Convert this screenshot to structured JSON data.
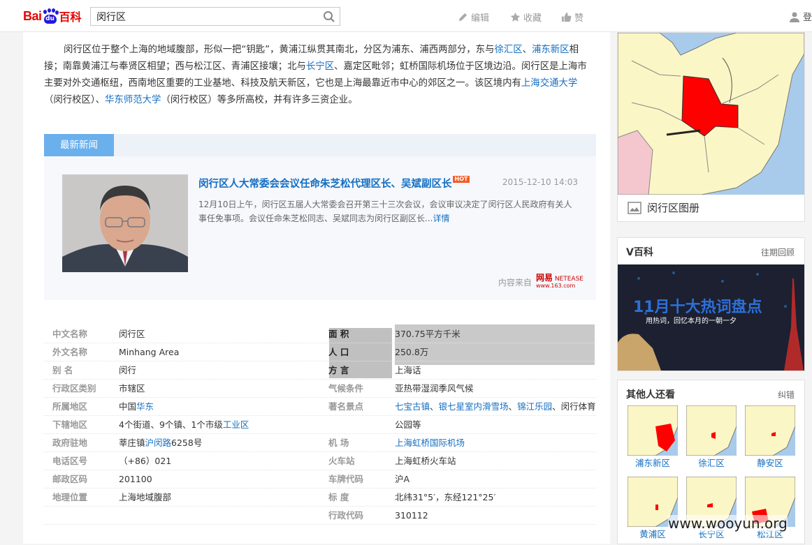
{
  "header": {
    "logo_bai": "Bai",
    "logo_du": "du",
    "logo_baike": "百科",
    "search_value": "闵行区",
    "edit_label": "编辑",
    "collect_label": "收藏",
    "like_label": "赞",
    "login_label": "登"
  },
  "intro": {
    "p1": "闵行区位于整个上海的地域腹部，形似一把“钥匙”，黄浦江纵贯其南北，分区为浦东、浦西两部分，东与",
    "link_xuhui": "徐汇区",
    "sep1": "、",
    "link_pudong": "浦东新区",
    "p2": "相接；南靠黄浦江与奉贤区相望；西与松江区、青浦区接壤；北与",
    "link_changning": "长宁区",
    "p3": "、嘉定区毗邻；虹桥国际机场位于区境边沿。闵行区是上海市主要对外交通枢纽，西南地区重要的工业基地、科技及航天新区，它也是上海最靠近市中心的郊区之一。该区境内有",
    "link_sjtu": "上海交通大学",
    "p4": "（闵行校区）、",
    "link_ecnu": "华东师范大学",
    "p5": "（闵行校区）等多所高校，并有许多三资企业。"
  },
  "news": {
    "tab_label": "最新新闻",
    "title": "闵行区人大常委会会议任命朱芝松代理区长、吴斌副区长",
    "hot_badge": "HOT",
    "date": "2015-12-10 14:03",
    "summary": "12月10日上午，闵行区五届人大常委会召开第三十三次会议，会议审议决定了闵行区人民政府有关人事任免事项。会议任命朱芝松同志、吴斌同志为闵行区副区长...",
    "detail_link": "详情",
    "source_label": "内容来自",
    "source_logo_cn": "网易",
    "source_logo_en": "NETEASE",
    "source_logo_url": "www.163.com"
  },
  "info": {
    "left": [
      {
        "label": "中文名称",
        "value": "闵行区",
        "link": true
      },
      {
        "label": "外文名称",
        "value": "Minhang Area"
      },
      {
        "label": "别    名",
        "value": "闵行"
      },
      {
        "label": "行政区类别",
        "value": "市辖区"
      },
      {
        "label": "所属地区",
        "value_prefix": "中国",
        "value_link": "华东"
      },
      {
        "label": "下辖地区",
        "value_prefix": "4个街道、9个镇、1个市级",
        "value_link": "工业区"
      },
      {
        "label": "",
        "value": ""
      },
      {
        "label": "政府驻地",
        "value_prefix": "莘庄镇",
        "value_link": "沪闵路",
        "value_suffix": "6258号"
      },
      {
        "label": "电话区号",
        "value": "（+86）021"
      },
      {
        "label": "邮政区码",
        "value": "201100"
      },
      {
        "label": "地理位置",
        "value": "上海地域腹部"
      }
    ],
    "right": [
      {
        "label": "面    积",
        "value": "370.75平方千米"
      },
      {
        "label": "人    口",
        "value": "250.8万"
      },
      {
        "label": "方    言",
        "value": "上海话"
      },
      {
        "label": "气候条件",
        "value": "亚热带湿润季风气候"
      },
      {
        "label": "著名景点",
        "value_link1": "七宝古镇",
        "sep1": "、",
        "value_link2": "银七星室内滑雪场",
        "sep2": "、",
        "value_link3": "锦江乐园",
        "value_suffix": "、闵行体育"
      },
      {
        "label": "",
        "value": "公园等"
      },
      {
        "label": "机    场",
        "value_link": "上海虹桥国际机场"
      },
      {
        "label": "火车站",
        "value": "上海虹桥火车站"
      },
      {
        "label": "车牌代码",
        "value": "沪A"
      },
      {
        "label": "标    度",
        "value": "北纬31°5′，东经121°25′"
      },
      {
        "label": "行政代码",
        "value": "310112"
      }
    ]
  },
  "sidebar": {
    "map_caption": "闵行区图册",
    "vbaike_title": "V百科",
    "vbaike_more": "往期回顾",
    "banner_big": "11月十大热词盘点",
    "banner_small": "用热词，回忆本月的一朝一夕",
    "others_title": "其他人还看",
    "others_more": "纠错",
    "others": [
      "浦东新区",
      "徐汇区",
      "静安区",
      "黄浦区",
      "长宁区",
      "松江区"
    ]
  },
  "watermark": "www.wooyun.org",
  "colors": {
    "link": "#136ec2",
    "accent_tab": "#6ab0ed",
    "map_highlight": "#ff0000",
    "map_land": "#fbf6c5",
    "map_water": "#a9cbeb"
  }
}
